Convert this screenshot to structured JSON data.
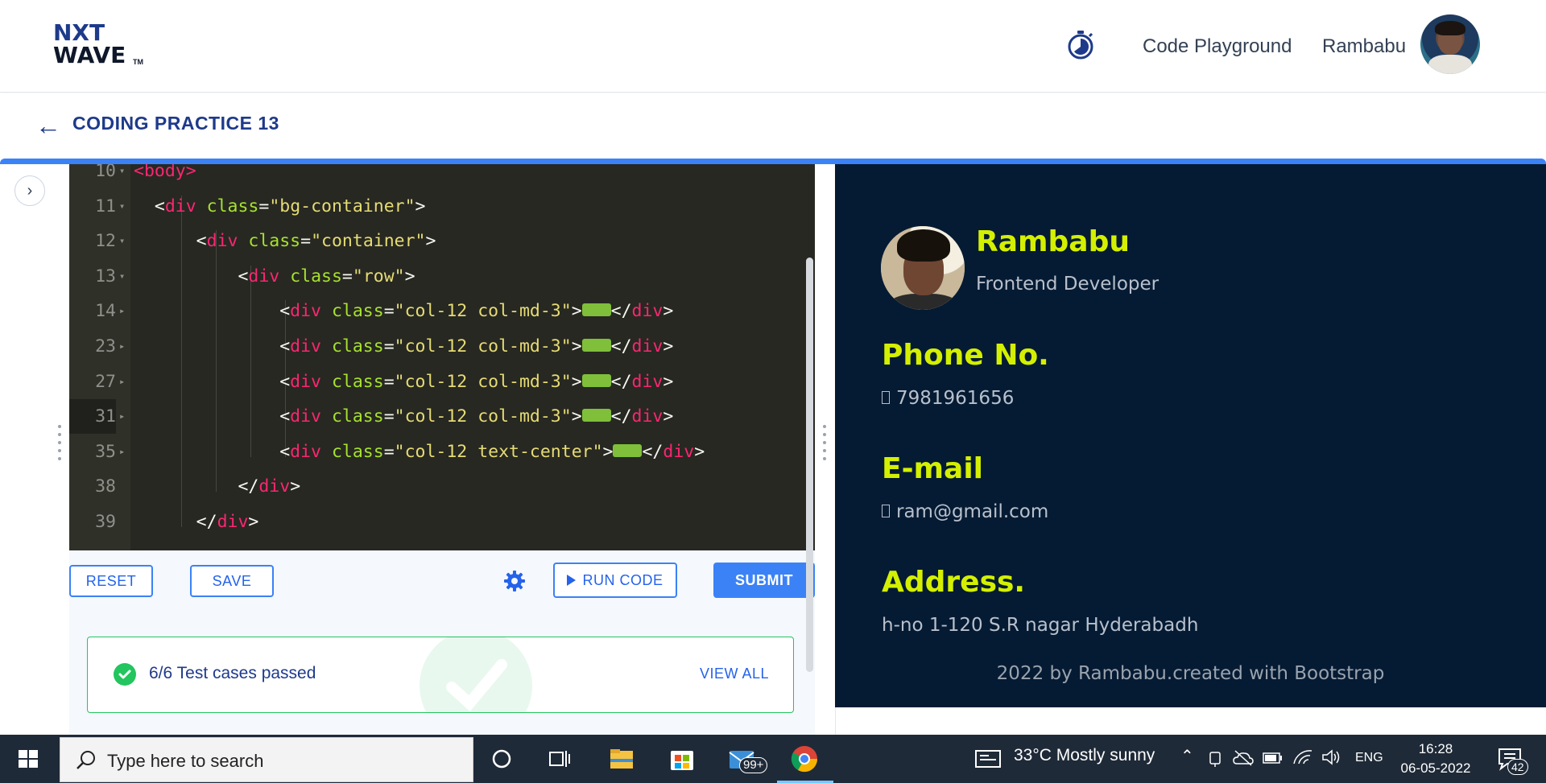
{
  "header": {
    "logo_line1": "NXT",
    "logo_line2": "WAVE",
    "logo_tm": "TM",
    "code_playground": "Code Playground",
    "username": "Rambabu"
  },
  "subheader": {
    "back_icon": "arrow-left-icon",
    "title": "CODING PRACTICE 13"
  },
  "editor": {
    "lines": [
      {
        "num": "10",
        "parts": [
          [
            "tg",
            "<body"
          ],
          [
            "tg",
            ">"
          ]
        ]
      },
      {
        "num": "11",
        "parts": [
          [
            "br",
            "  "
          ],
          [
            "br",
            "<"
          ],
          [
            "tg",
            "div "
          ],
          [
            "at",
            "class"
          ],
          [
            "br",
            "="
          ],
          [
            "st",
            "\"bg-container\""
          ],
          [
            "br",
            ">"
          ]
        ]
      },
      {
        "num": "12",
        "parts": [
          [
            "br",
            "      "
          ],
          [
            "br",
            "<"
          ],
          [
            "tg",
            "div "
          ],
          [
            "at",
            "class"
          ],
          [
            "br",
            "="
          ],
          [
            "st",
            "\"container\""
          ],
          [
            "br",
            ">"
          ]
        ]
      },
      {
        "num": "13",
        "parts": [
          [
            "br",
            "          "
          ],
          [
            "br",
            "<"
          ],
          [
            "tg",
            "div "
          ],
          [
            "at",
            "class"
          ],
          [
            "br",
            "="
          ],
          [
            "st",
            "\"row\""
          ],
          [
            "br",
            ">"
          ]
        ]
      },
      {
        "num": "14",
        "parts": [
          [
            "br",
            "              "
          ],
          [
            "br",
            "<"
          ],
          [
            "tg",
            "div "
          ],
          [
            "at",
            "class"
          ],
          [
            "br",
            "="
          ],
          [
            "st",
            "\"col-12 col-md-3\""
          ],
          [
            "br",
            ">"
          ],
          [
            "fm",
            ""
          ],
          [
            "br",
            "</"
          ],
          [
            "tg",
            "div"
          ],
          [
            "br",
            ">"
          ]
        ]
      },
      {
        "num": "23",
        "parts": [
          [
            "br",
            "              "
          ],
          [
            "br",
            "<"
          ],
          [
            "tg",
            "div "
          ],
          [
            "at",
            "class"
          ],
          [
            "br",
            "="
          ],
          [
            "st",
            "\"col-12 col-md-3\""
          ],
          [
            "br",
            ">"
          ],
          [
            "fm",
            ""
          ],
          [
            "br",
            "</"
          ],
          [
            "tg",
            "div"
          ],
          [
            "br",
            ">"
          ]
        ]
      },
      {
        "num": "27",
        "parts": [
          [
            "br",
            "              "
          ],
          [
            "br",
            "<"
          ],
          [
            "tg",
            "div "
          ],
          [
            "at",
            "class"
          ],
          [
            "br",
            "="
          ],
          [
            "st",
            "\"col-12 col-md-3\""
          ],
          [
            "br",
            ">"
          ],
          [
            "fm",
            ""
          ],
          [
            "br",
            "</"
          ],
          [
            "tg",
            "div"
          ],
          [
            "br",
            ">"
          ]
        ]
      },
      {
        "num": "31",
        "parts": [
          [
            "br",
            "              "
          ],
          [
            "br",
            "<"
          ],
          [
            "tg",
            "div "
          ],
          [
            "at",
            "class"
          ],
          [
            "br",
            "="
          ],
          [
            "st",
            "\"col-12 col-md-3\""
          ],
          [
            "br",
            ">"
          ],
          [
            "fm",
            ""
          ],
          [
            "br",
            "</"
          ],
          [
            "tg",
            "div"
          ],
          [
            "br",
            ">"
          ]
        ],
        "active": true
      },
      {
        "num": "35",
        "parts": [
          [
            "br",
            "              "
          ],
          [
            "br",
            "<"
          ],
          [
            "tg",
            "div "
          ],
          [
            "at",
            "class"
          ],
          [
            "br",
            "="
          ],
          [
            "st",
            "\"col-12 text-center\""
          ],
          [
            "br",
            ">"
          ],
          [
            "fm",
            ""
          ],
          [
            "br",
            "</"
          ],
          [
            "tg",
            "div"
          ],
          [
            "br",
            ">"
          ]
        ]
      },
      {
        "num": "38",
        "parts": [
          [
            "br",
            "          "
          ],
          [
            "br",
            "</"
          ],
          [
            "tg",
            "div"
          ],
          [
            "br",
            ">"
          ]
        ]
      },
      {
        "num": "39",
        "parts": [
          [
            "br",
            "      "
          ],
          [
            "br",
            "</"
          ],
          [
            "tg",
            "div"
          ],
          [
            "br",
            ">"
          ]
        ]
      }
    ]
  },
  "actions": {
    "reset": "RESET",
    "save": "SAVE",
    "run_code": "RUN CODE",
    "submit": "SUBMIT"
  },
  "tests": {
    "status": "6/6 Test cases passed",
    "view_all": "VIEW ALL"
  },
  "preview": {
    "name": "Rambabu",
    "role": "Frontend Developer",
    "phone_heading": "Phone No.",
    "phone": "7981961656",
    "email_heading": "E-mail",
    "email": "ram@gmail.com",
    "address_heading": "Address.",
    "address": "h-no 1-120 S.R nagar Hyderabadh",
    "footer": "2022 by Rambabu.created with Bootstrap",
    "accent_color": "#d4f000",
    "background_color": "#051b33"
  },
  "taskbar": {
    "search_placeholder": "Type here to search",
    "mail_badge": "99+",
    "weather": "33°C  Mostly sunny",
    "lang": "ENG",
    "time": "16:28",
    "date": "06-05-2022",
    "notifications": "42"
  },
  "colors": {
    "brand_blue": "#3b82f6",
    "navy": "#1e3a8a",
    "success": "#22c55e"
  }
}
